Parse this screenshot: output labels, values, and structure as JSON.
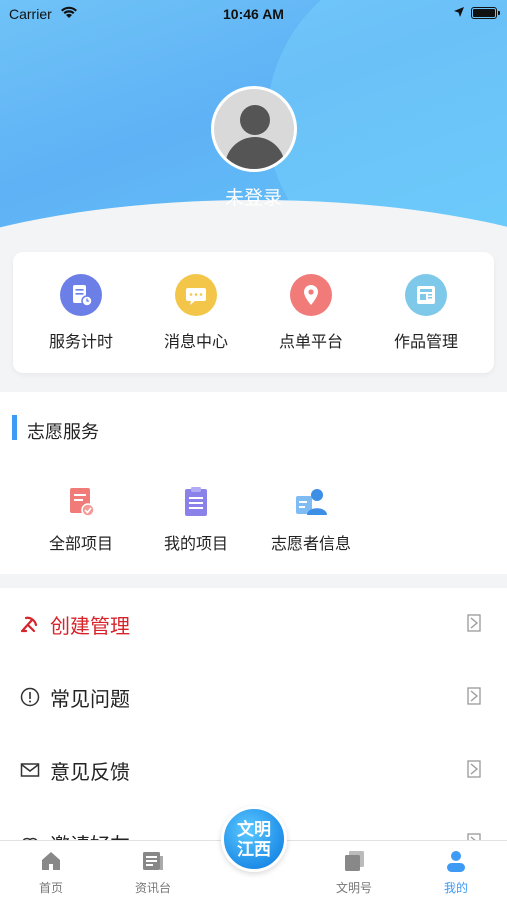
{
  "status_bar": {
    "carrier": "Carrier",
    "time": "10:46 AM"
  },
  "profile": {
    "login_status": "未登录"
  },
  "quick_actions": [
    {
      "label": "服务计时",
      "color": "#6c7fe6",
      "icon": "timer-doc-icon"
    },
    {
      "label": "消息中心",
      "color": "#f3c64a",
      "icon": "message-icon"
    },
    {
      "label": "点单平台",
      "color": "#f07b78",
      "icon": "location-pin-icon"
    },
    {
      "label": "作品管理",
      "color": "#7ec8e9",
      "icon": "works-icon"
    }
  ],
  "volunteer": {
    "title": "志愿服务",
    "items": [
      {
        "label": "全部项目",
        "color": "#f07b78",
        "icon": "all-projects-icon"
      },
      {
        "label": "我的项目",
        "color": "#8a82e8",
        "icon": "clipboard-icon"
      },
      {
        "label": "志愿者信息",
        "color": "#5aa6ee",
        "icon": "volunteer-id-icon"
      }
    ]
  },
  "menu": [
    {
      "label": "创建管理",
      "color": "#d6242a",
      "icon": "party-emblem-icon"
    },
    {
      "label": "常见问题",
      "color": "#222222",
      "icon": "exclamation-circle-icon"
    },
    {
      "label": "意见反馈",
      "color": "#222222",
      "icon": "envelope-icon"
    },
    {
      "label": "邀请好友",
      "color": "#222222",
      "icon": "link-icon"
    }
  ],
  "tabbar": {
    "tabs": [
      {
        "label": "首页",
        "icon": "home-icon"
      },
      {
        "label": "资讯台",
        "icon": "news-icon"
      },
      {
        "label": "文明号",
        "icon": "copy-icon"
      },
      {
        "label": "我的",
        "icon": "person-icon"
      }
    ],
    "center": {
      "line1": "文明",
      "line2": "江西"
    },
    "active_color": "#3d9bf5"
  }
}
